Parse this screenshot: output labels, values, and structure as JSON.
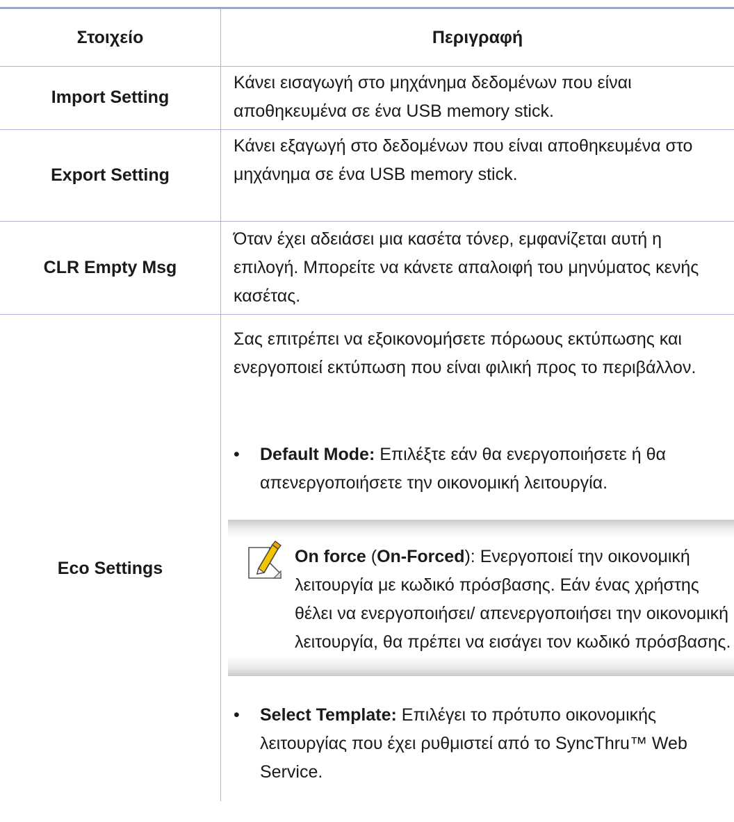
{
  "header": {
    "col_item": "Στοιχείο",
    "col_description": "Περιγραφή"
  },
  "rows": {
    "import": {
      "item": "Import Setting",
      "description": "Κάνει εισαγωγή στο μηχάνημα δεδομένων που είναι αποθηκευμένα σε ένα USB memory stick."
    },
    "export": {
      "item": "Export Setting",
      "description": "Κάνει εξαγωγή στο δεδομένων που είναι αποθηκευμένα στο μηχάνημα σε ένα USB memory stick."
    },
    "clr": {
      "item": "CLR Empty Msg",
      "description": "Όταν έχει αδειάσει μια κασέτα τόνερ, εμφανίζεται αυτή η επιλογή. Μπορείτε να κάνετε απαλοιφή του μηνύματος κενής κασέτας."
    },
    "eco": {
      "item": "Eco Settings",
      "intro": "Σας επιτρέπει να εξοικονομήσετε πόρωους εκτύπωσης και ενεργοποιεί εκτύπωση που είναι φιλική προς το περιβάλλον.",
      "bullet_char": "•",
      "default_mode_label": "Default Mode:",
      "default_mode_text": " Επιλέξτε εάν θα ενεργοποιήσετε ή θα απενεργοποιήσετε την οικονομική λειτουργία.",
      "note": {
        "icon": "note-pencil-icon",
        "on_force": "On force",
        "open_paren": " (",
        "on_forced": "On-Forced",
        "rest": "): Ενεργοποιεί την οικονομική λειτουργία με κωδικό πρόσβασης. Εάν ένας χρήστης θέλει να ενεργοποιήσει/ απενεργοποιήσει την οικονομική λειτουργία, θα πρέπει να εισάγει τον κωδικό πρόσβασης."
      },
      "select_template_label": "Select Template:",
      "select_template_text": " Επιλέγει το πρότυπο οικονομικής λειτουργίας που έχει ρυθμιστεί από το SyncThru™ Web Service."
    }
  },
  "colors": {
    "rule": "#9ea3cc",
    "grid": "#aeb2d6",
    "note_shade": "#cacaca"
  }
}
